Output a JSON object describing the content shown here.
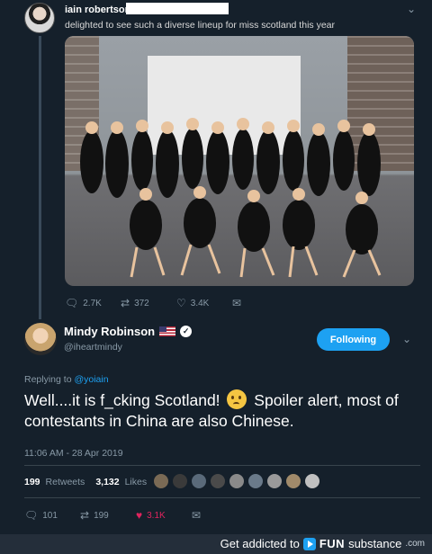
{
  "reply_tweet": {
    "author": "iain robertson",
    "text": "delighted to see such a diverse lineup for miss scotland this year",
    "menu_icon": "chevron-down-icon",
    "actions": {
      "replies": "2.7K",
      "retweets": "372",
      "likes": "3.4K"
    }
  },
  "main_tweet": {
    "name": "Mindy Robinson",
    "handle": "@iheartmindy",
    "follow_label": "Following",
    "replying_to_prefix": "Replying to ",
    "replying_to_user": "@yoiain",
    "text_part1": "Well....it is f_cking Scotland!",
    "text_part2": "Spoiler alert, most of contestants in China are also Chinese.",
    "timestamp": "11:06 AM - 28 Apr 2019",
    "retweets_count": "199",
    "retweets_label": "Retweets",
    "likes_count": "3,132",
    "likes_label": "Likes",
    "actions": {
      "replies": "101",
      "retweets": "199",
      "likes": "3.1K"
    },
    "colors": {
      "accent": "#1da1f2",
      "like": "#e0245e",
      "background": "#15202b"
    }
  },
  "footer": {
    "prefix": "Get addicted to",
    "brand_bold": "FUN",
    "brand_regular": "substance",
    "brand_suffix": ".com"
  }
}
